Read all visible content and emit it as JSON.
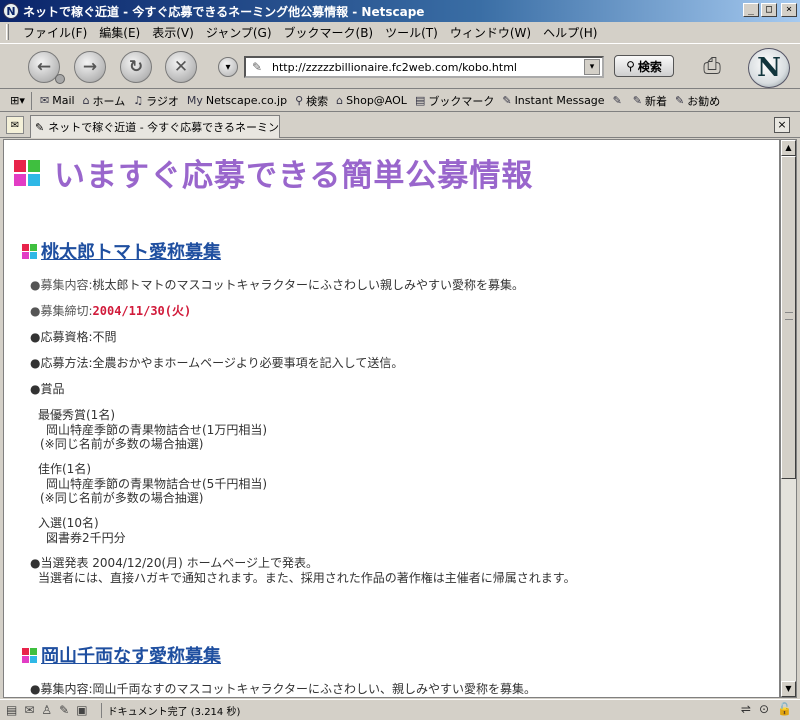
{
  "window": {
    "title": "ネットで稼ぐ近道 - 今すぐ応募できるネーミング他公募情報 - Netscape",
    "app_icon": "N",
    "min_icon": "_",
    "max_icon": "□",
    "close_icon": "×"
  },
  "menu": {
    "items": [
      "ファイル(F)",
      "編集(E)",
      "表示(V)",
      "ジャンプ(G)",
      "ブックマーク(B)",
      "ツール(T)",
      "ウィンドウ(W)",
      "ヘルプ(H)"
    ]
  },
  "nav": {
    "back_glyph": "←",
    "forward_glyph": "→",
    "reload_glyph": "↻",
    "stop_glyph": "✕",
    "url": "http://zzzzzbillionaire.fc2web.com/kobo.html",
    "search_label": "検索",
    "logo_letter": "N"
  },
  "personal_toolbar": {
    "items": [
      {
        "icon": "✉",
        "label": "Mail"
      },
      {
        "icon": "⌂",
        "label": "ホーム"
      },
      {
        "icon": "♫",
        "label": "ラジオ"
      },
      {
        "icon": "My",
        "label": "Netscape.co.jp"
      },
      {
        "icon": "⚲",
        "label": "検索"
      },
      {
        "icon": "⌂",
        "label": "Shop@AOL"
      },
      {
        "icon": "▤",
        "label": "ブックマーク"
      },
      {
        "icon": "✎",
        "label": "Instant Message"
      },
      {
        "icon": "✎",
        "label": ""
      },
      {
        "icon": "✎",
        "label": "新着"
      },
      {
        "icon": "✎",
        "label": "お勧め"
      }
    ]
  },
  "tab": {
    "label": "ネットで稼ぐ近道 - 今すぐ応募できるネーミング..."
  },
  "colors": {
    "logo_red": "#e8234a",
    "logo_green": "#3fbf3f",
    "logo_magenta": "#e23cc4",
    "logo_cyan": "#2fb8e6",
    "title_purple": "#9966cc",
    "link_blue": "#1f4fa0",
    "deadline_red": "#d11a3a"
  },
  "page": {
    "title": "いますぐ応募できる簡単公募情報",
    "section1": {
      "heading": "桃太郎トマト愛称募集",
      "content_label": "●募集内容:",
      "content": "桃太郎トマトのマスコットキャラクターにふさわしい親しみやすい愛称を募集。",
      "deadline_label": "●募集締切:",
      "deadline": "2004/11/30(火)",
      "eligibility": "●応募資格:不問",
      "method": "●応募方法:全農おかやまホームページより必要事項を記入して送信。",
      "prize_label": "●賞品",
      "prize1_name": "最優秀賞(1名)",
      "prize1_item": "岡山特産季節の青果物詰合せ(1万円相当)",
      "prize1_note": "(※同じ名前が多数の場合抽選)",
      "prize2_name": "佳作(1名)",
      "prize2_item": "岡山特産季節の青果物詰合せ(5千円相当)",
      "prize2_note": "(※同じ名前が多数の場合抽選)",
      "prize3_name": "入選(10名)",
      "prize3_item": "図書券2千円分",
      "announce": "●当選発表 2004/12/20(月) ホームページ上で発表。",
      "announce_note": "当選者には、直接ハガキで通知されます。また、採用された作品の著作権は主催者に帰属されます。"
    },
    "section2": {
      "heading": "岡山千両なす愛称募集",
      "content": "●募集内容:岡山千両なすのマスコットキャラクターにふさわしい、親しみやすい愛称を募集。"
    }
  },
  "status": {
    "text": "ドキュメント完了 (3.214 秒)"
  }
}
